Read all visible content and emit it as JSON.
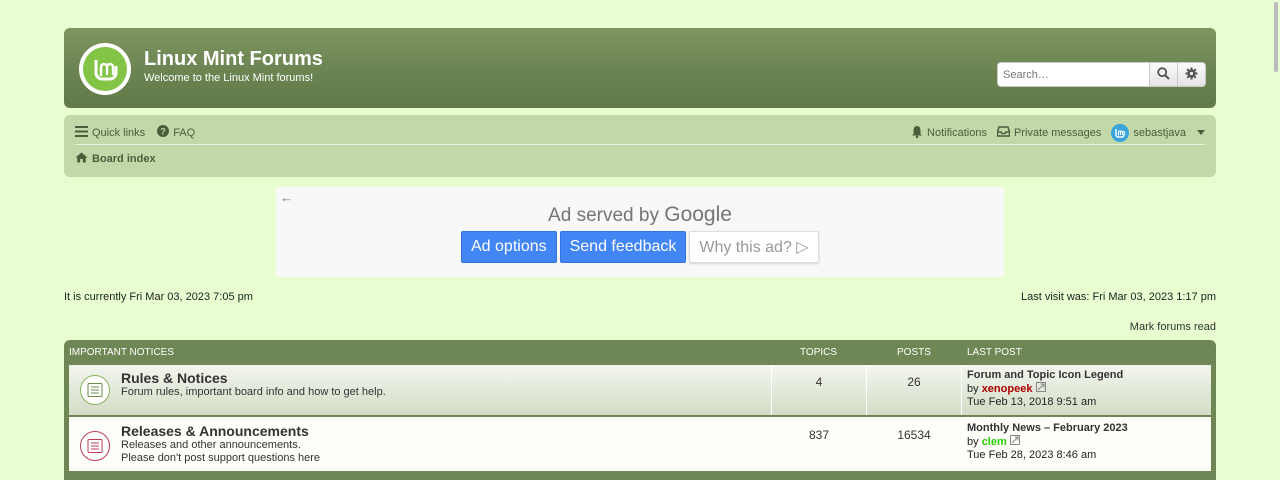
{
  "header": {
    "site_title": "Linux Mint Forums",
    "site_description": "Welcome to the Linux Mint forums!",
    "search_placeholder": "Search…"
  },
  "nav": {
    "quick_links": "Quick links",
    "faq": "FAQ",
    "notifications": "Notifications",
    "private_messages": "Private messages",
    "username": "sebastjava",
    "board_index": "Board index"
  },
  "ad": {
    "served_by": "Ad served by",
    "google": "Google",
    "options": "Ad options",
    "feedback": "Send feedback",
    "why": "Why this ad? ▷"
  },
  "status": {
    "current_time": "It is currently Fri Mar 03, 2023 7:05 pm",
    "last_visit": "Last visit was: Fri Mar 03, 2023 1:17 pm",
    "mark_read": "Mark forums read"
  },
  "forum_table": {
    "headers": {
      "section": "Important Notices",
      "topics": "Topics",
      "posts": "Posts",
      "last_post": "Last post"
    },
    "rows": [
      {
        "title": "Rules & Notices",
        "description": "Forum rules, important board info and how to get help.",
        "description2": "",
        "topics": "4",
        "posts": "26",
        "last_post_title": "Forum and Topic Icon Legend",
        "by": "by",
        "last_post_user": "xenopeek",
        "last_post_time": "Tue Feb 13, 2018 9:51 am"
      },
      {
        "title": "Releases & Announcements",
        "description": "Releases and other announcements.",
        "description2": "Please don't post support questions here",
        "topics": "837",
        "posts": "16534",
        "last_post_title": "Monthly News – February 2023",
        "by": "by",
        "last_post_user": "clem",
        "last_post_time": "Tue Feb 28, 2023 8:46 am"
      }
    ]
  },
  "colors": {
    "page_bg": "#e8fed0",
    "header_bg": "#6c8452",
    "navbar_bg": "#c3d8a8",
    "mint_green": "#83c447",
    "ad_blue": "#4285f4",
    "user_red": "#aa0000",
    "user_green": "#2bcd00"
  },
  "icons": [
    "linux-mint-logo-icon",
    "search-icon",
    "gear-icon",
    "bars-icon",
    "question-icon",
    "bell-icon",
    "inbox-icon",
    "home-icon",
    "arrow-left-icon",
    "forum-read-icon",
    "view-post-icon"
  ]
}
